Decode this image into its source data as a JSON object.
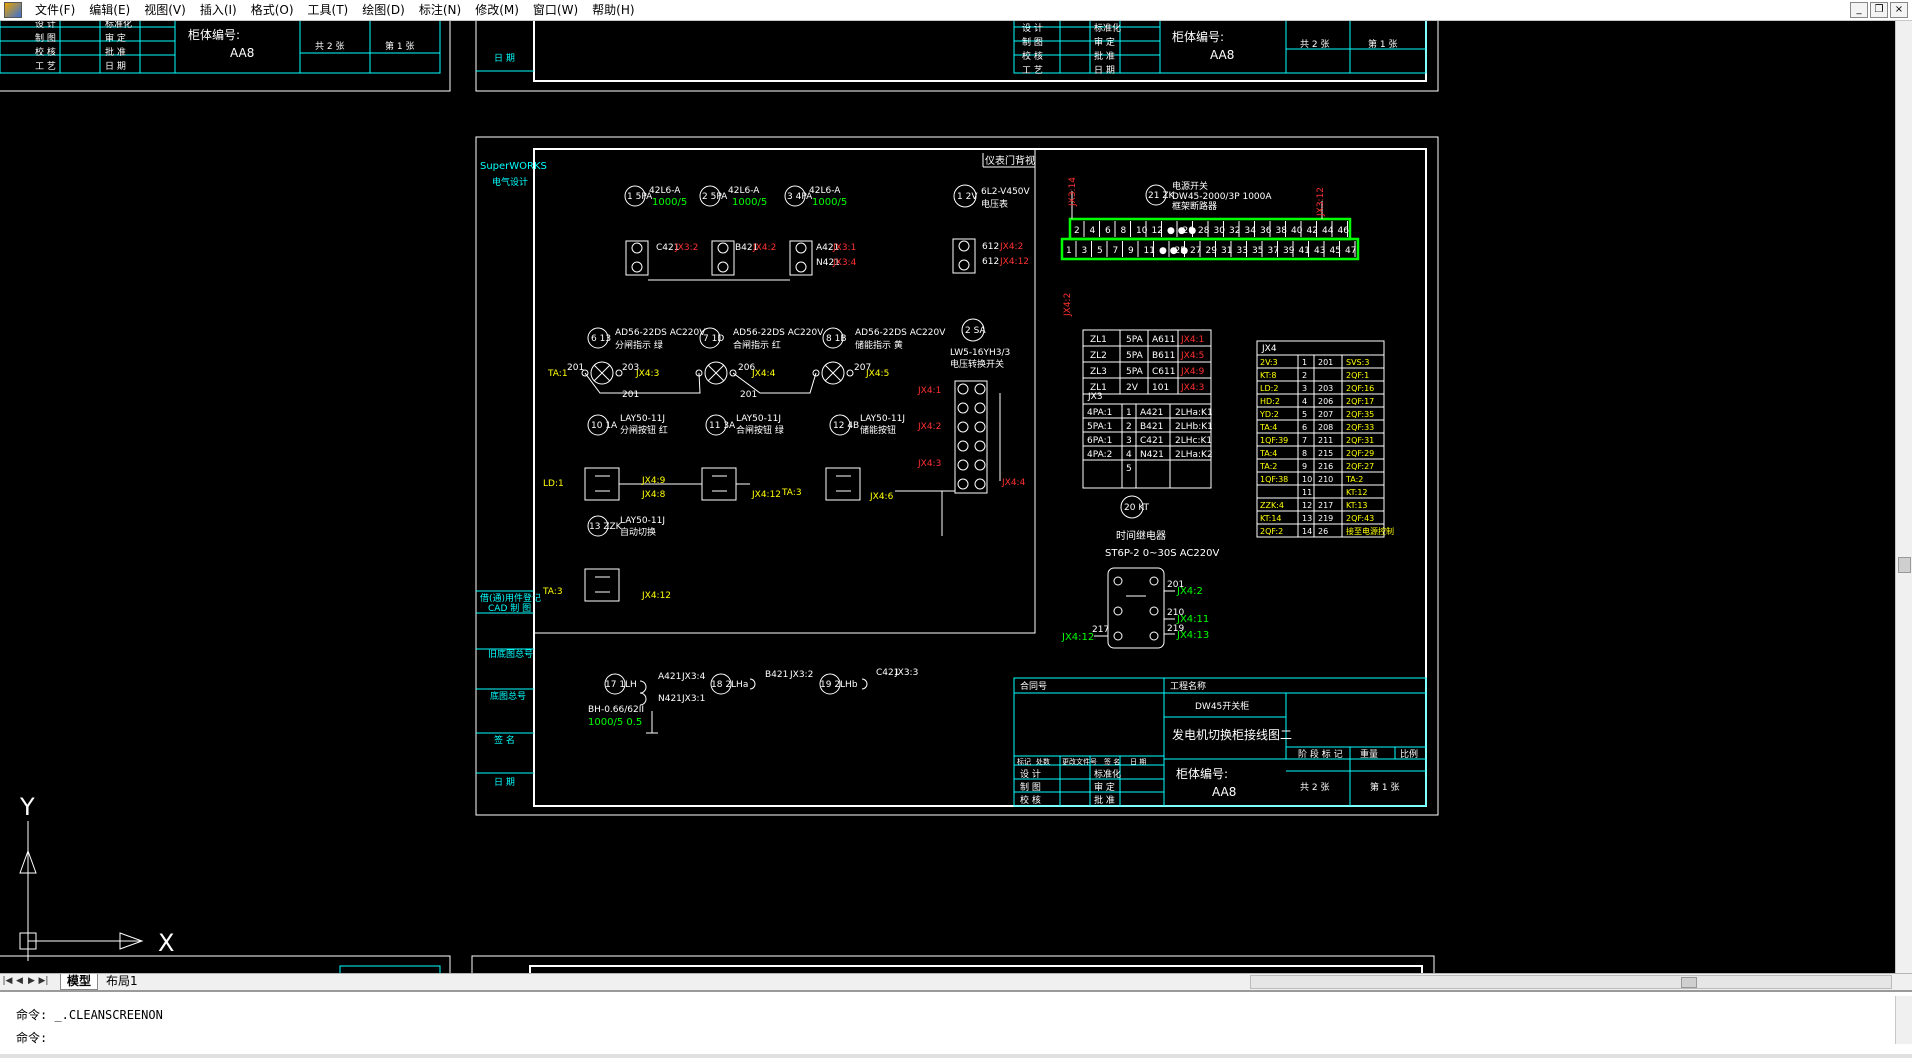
{
  "menu": [
    "文件(F)",
    "编辑(E)",
    "视图(V)",
    "插入(I)",
    "格式(O)",
    "工具(T)",
    "绘图(D)",
    "标注(N)",
    "修改(M)",
    "窗口(W)",
    "帮助(H)"
  ],
  "tabs": {
    "model": "模型",
    "layout1": "布局1"
  },
  "command": {
    "line1": "命令: _.CLEANSCREENON",
    "line2": "命令:"
  },
  "ucs": {
    "x": "X",
    "y": "Y"
  },
  "drawing": {
    "brand": "SuperWORKS",
    "brand_sub": "电气设计",
    "panel_title": "仪表门背视",
    "left_strip": [
      "借(通)用件登记",
      "CAD 制 图",
      "旧底图总号",
      "底图总号",
      "签 名",
      "日 期"
    ],
    "top_left_block": [
      "设 计",
      "制 图",
      "校 核",
      "工 艺",
      "标准化",
      "审 定",
      "批 准",
      "日 期",
      "共 2 张",
      "第 1 张"
    ],
    "top_left_cabinet_label": "柜体编号:",
    "top_left_cabinet_value": "AA8",
    "top_mid_label": "日 期",
    "ct_labels": [
      "1 5PA",
      "2 5PA",
      "3 4PA"
    ],
    "ct_model": "42L6-A",
    "ct_ratio": "1000/5",
    "ct_terms": [
      "JX3:2",
      "JX4:2",
      "JX3:1",
      "JX3:4"
    ],
    "ct_wires": [
      "C421",
      "B421",
      "A421",
      "N421"
    ],
    "voltmeter_id": "1 2V",
    "voltmeter_model": "6L2-V450V",
    "voltmeter_name": "电压表",
    "voltmeter_terms": [
      "JX4:2",
      "JX4:12"
    ],
    "voltmeter_wires": [
      "612",
      "612"
    ],
    "lamps": [
      {
        "id": "6 13",
        "model": "AD56-22DS AC220V",
        "name": "分闸指示 绿"
      },
      {
        "id": "7 1D",
        "model": "AD56-22DS AC220V",
        "name": "合闸指示 红"
      },
      {
        "id": "8 1B",
        "model": "AD56-22DS AC220V",
        "name": "储能指示 黄"
      }
    ],
    "lamp_terms": [
      "TA:1",
      "JX4:3",
      "JX4:4",
      "JX4:5"
    ],
    "lamp_wires": [
      "201",
      "203",
      "201",
      "206",
      "201",
      "207"
    ],
    "switch_id": "2 SA",
    "switch_model": "LW5-16YH3/3",
    "switch_name": "电压转换开关",
    "switch_terms": [
      "JX4:1",
      "JX4:2",
      "JX4:3",
      "JX4:4"
    ],
    "buttons": [
      {
        "id": "10 1A",
        "model": "LAY50-11J",
        "name": "分闸按钮 红"
      },
      {
        "id": "11 3A",
        "model": "LAY50-11J",
        "name": "合闸按钮 绿"
      },
      {
        "id": "12 4B",
        "model": "LAY50-11J",
        "name": "储能按钮"
      },
      {
        "id": "13 ZZK",
        "model": "LAY50-11J",
        "name": "自动切换"
      }
    ],
    "button_terms": [
      "LD:1",
      "JX4:9",
      "JX4:8",
      "JX4:12",
      "TA:3",
      "JX4:6",
      "TA:3",
      "JX4:12"
    ],
    "terminal_top": [
      "2",
      "4",
      "6",
      "8",
      "10",
      "12",
      "● ● ●",
      "26",
      "28",
      "30",
      "32",
      "34",
      "36",
      "38",
      "40",
      "42",
      "44",
      "46"
    ],
    "terminal_bottom": [
      "1",
      "3",
      "5",
      "7",
      "9",
      "11",
      "● ● ●",
      "25",
      "27",
      "29",
      "31",
      "33",
      "35",
      "37",
      "39",
      "41",
      "43",
      "45",
      "47"
    ],
    "terminal_header": "电源开关",
    "terminal_header2": "DW45-2000/3P 1000A",
    "terminal_sub": "框架断路器",
    "terminal_id": "21 ZK",
    "table1_rows": [
      [
        "ZL1",
        "5PA",
        "A611",
        "JX4:1"
      ],
      [
        "ZL2",
        "5PA",
        "B611",
        "JX4:5"
      ],
      [
        "ZL3",
        "5PA",
        "C611",
        "JX4:9"
      ],
      [
        "ZL1",
        "2V",
        "101",
        "JX4:3"
      ]
    ],
    "table2_title": "JX3",
    "table2_rows": [
      [
        "4PA:1",
        "1",
        "A421",
        "2LHa:K1"
      ],
      [
        "5PA:1",
        "2",
        "B421",
        "2LHb:K1"
      ],
      [
        "6PA:1",
        "3",
        "C421",
        "2LHc:K1"
      ],
      [
        "4PA:2",
        "4",
        "N421",
        "2LHa:K2"
      ],
      [
        "",
        "5",
        "",
        ""
      ]
    ],
    "table3_title": "JX4",
    "table3_rows": [
      [
        "2V:3",
        "1",
        "201",
        "SVS:3"
      ],
      [
        "KT:8",
        "2",
        "",
        "2QF:1"
      ],
      [
        "LD:2",
        "3",
        "203",
        "2QF:16"
      ],
      [
        "HD:2",
        "4",
        "206",
        "2QF:17"
      ],
      [
        "YD:2",
        "5",
        "207",
        "2QF:35"
      ],
      [
        "TA:4",
        "6",
        "208",
        "2QF:33"
      ],
      [
        "1QF:39",
        "7",
        "211",
        "2QF:31"
      ],
      [
        "TA:4",
        "8",
        "215",
        "2QF:29"
      ],
      [
        "TA:2",
        "9",
        "216",
        "2QF:27"
      ],
      [
        "1QF:38",
        "10",
        "210",
        "TA:2"
      ],
      [
        "",
        "11",
        "",
        "KT:12"
      ],
      [
        "ZZK:4",
        "12",
        "217",
        "KT:13"
      ],
      [
        "KT:14",
        "13",
        "219",
        "2QF:43"
      ],
      [
        "2QF:2",
        "14",
        "26",
        "接至电源控制"
      ]
    ],
    "relay_id": "20 KT",
    "relay_name": "时间继电器",
    "relay_model": "ST6P-2 0~30S AC220V",
    "relay_terms": [
      "JX4:2",
      "JX4:11",
      "JX4:13",
      "JX4:12"
    ],
    "relay_wires": [
      "201",
      "210",
      "219",
      "217"
    ],
    "bottom_cts": [
      {
        "id": "17 1LH",
        "model": "BH-0.66/62II",
        "ratio": "1000/5 0.5"
      },
      {
        "id": "18 2LHa",
        "model": "",
        "ratio": ""
      },
      {
        "id": "19 2LHb",
        "model": "",
        "ratio": ""
      }
    ],
    "bottom_ct_terms": [
      "JX3:4",
      "JX3:1",
      "JX3:2",
      "JX3:3"
    ],
    "bottom_ct_wires": [
      "A421",
      "N421",
      "B421",
      "C421"
    ],
    "title_block": {
      "contract": "合同号",
      "project": "工程名称",
      "cabinet_type": "DW45开关柜",
      "drawing_name": "发电机切换柜接线图二",
      "stage_mark": "阶 段 标 记",
      "weight": "重量",
      "scale": "比例",
      "cabinet_label": "柜体编号:",
      "cabinet_value": "AA8",
      "sheets": "共 2 张",
      "sheet_no": "第 1 张",
      "roles": [
        "设 计",
        "制 图",
        "校 核",
        "工 艺"
      ],
      "checks": [
        "标准化",
        "审 定",
        "批 准",
        "日 期"
      ],
      "revisions_header": [
        "标记",
        "处数",
        "更改文件号",
        "签 名",
        "日 期"
      ]
    }
  },
  "colors": {
    "background": "#000000",
    "frame": "#ffffff",
    "cyan": "#00ffff",
    "yellow": "#ffff00",
    "red": "#ff0000",
    "green": "#00ff00"
  }
}
